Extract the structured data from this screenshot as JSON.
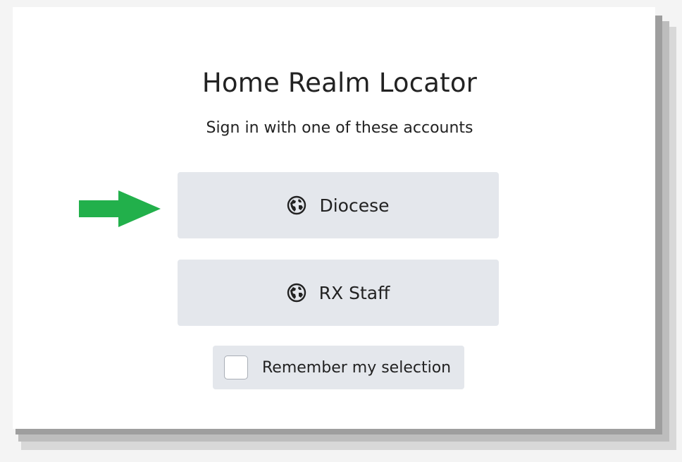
{
  "dialog": {
    "title": "Home Realm Locator",
    "subtitle": "Sign in with one of these accounts"
  },
  "realms": [
    {
      "label": "Diocese",
      "icon": "globe-icon"
    },
    {
      "label": "RX Staff",
      "icon": "globe-icon"
    }
  ],
  "remember": {
    "label": "Remember my selection",
    "checked": false
  },
  "annotation": {
    "arrow_icon": "arrow-right-icon",
    "arrow_color": "#22b04b"
  },
  "colors": {
    "button_bg": "#e4e7ec",
    "text": "#222222",
    "card_bg": "#ffffff"
  }
}
